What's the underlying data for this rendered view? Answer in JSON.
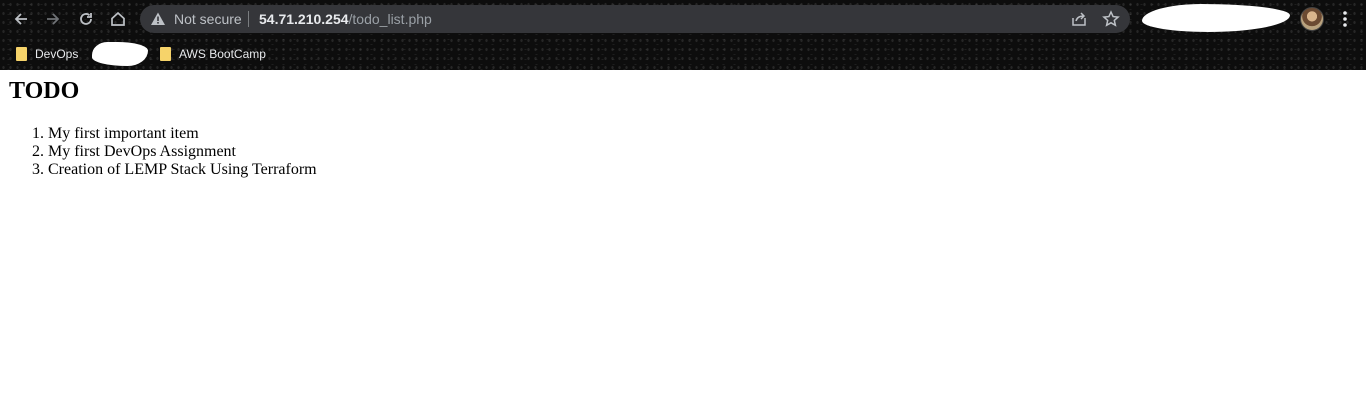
{
  "browser": {
    "security_label": "Not secure",
    "url_host": "54.71.210.254",
    "url_path": "/todo_list.php",
    "nav_icons": [
      "back-icon",
      "forward-icon",
      "reload-icon",
      "home-icon"
    ],
    "bookmarks": [
      {
        "label": "DevOps",
        "icon": "folder-icon"
      },
      {
        "label": "AWS BootCamp",
        "icon": "folder-icon"
      }
    ]
  },
  "page": {
    "title": "TODO",
    "items": [
      "My first important item",
      "My first DevOps Assignment",
      "Creation of LEMP Stack Using Terraform"
    ]
  },
  "colors": {
    "chrome_bg": "#0d0d0d",
    "omnibox_bg": "#35363a",
    "folder": "#f6d36a"
  }
}
